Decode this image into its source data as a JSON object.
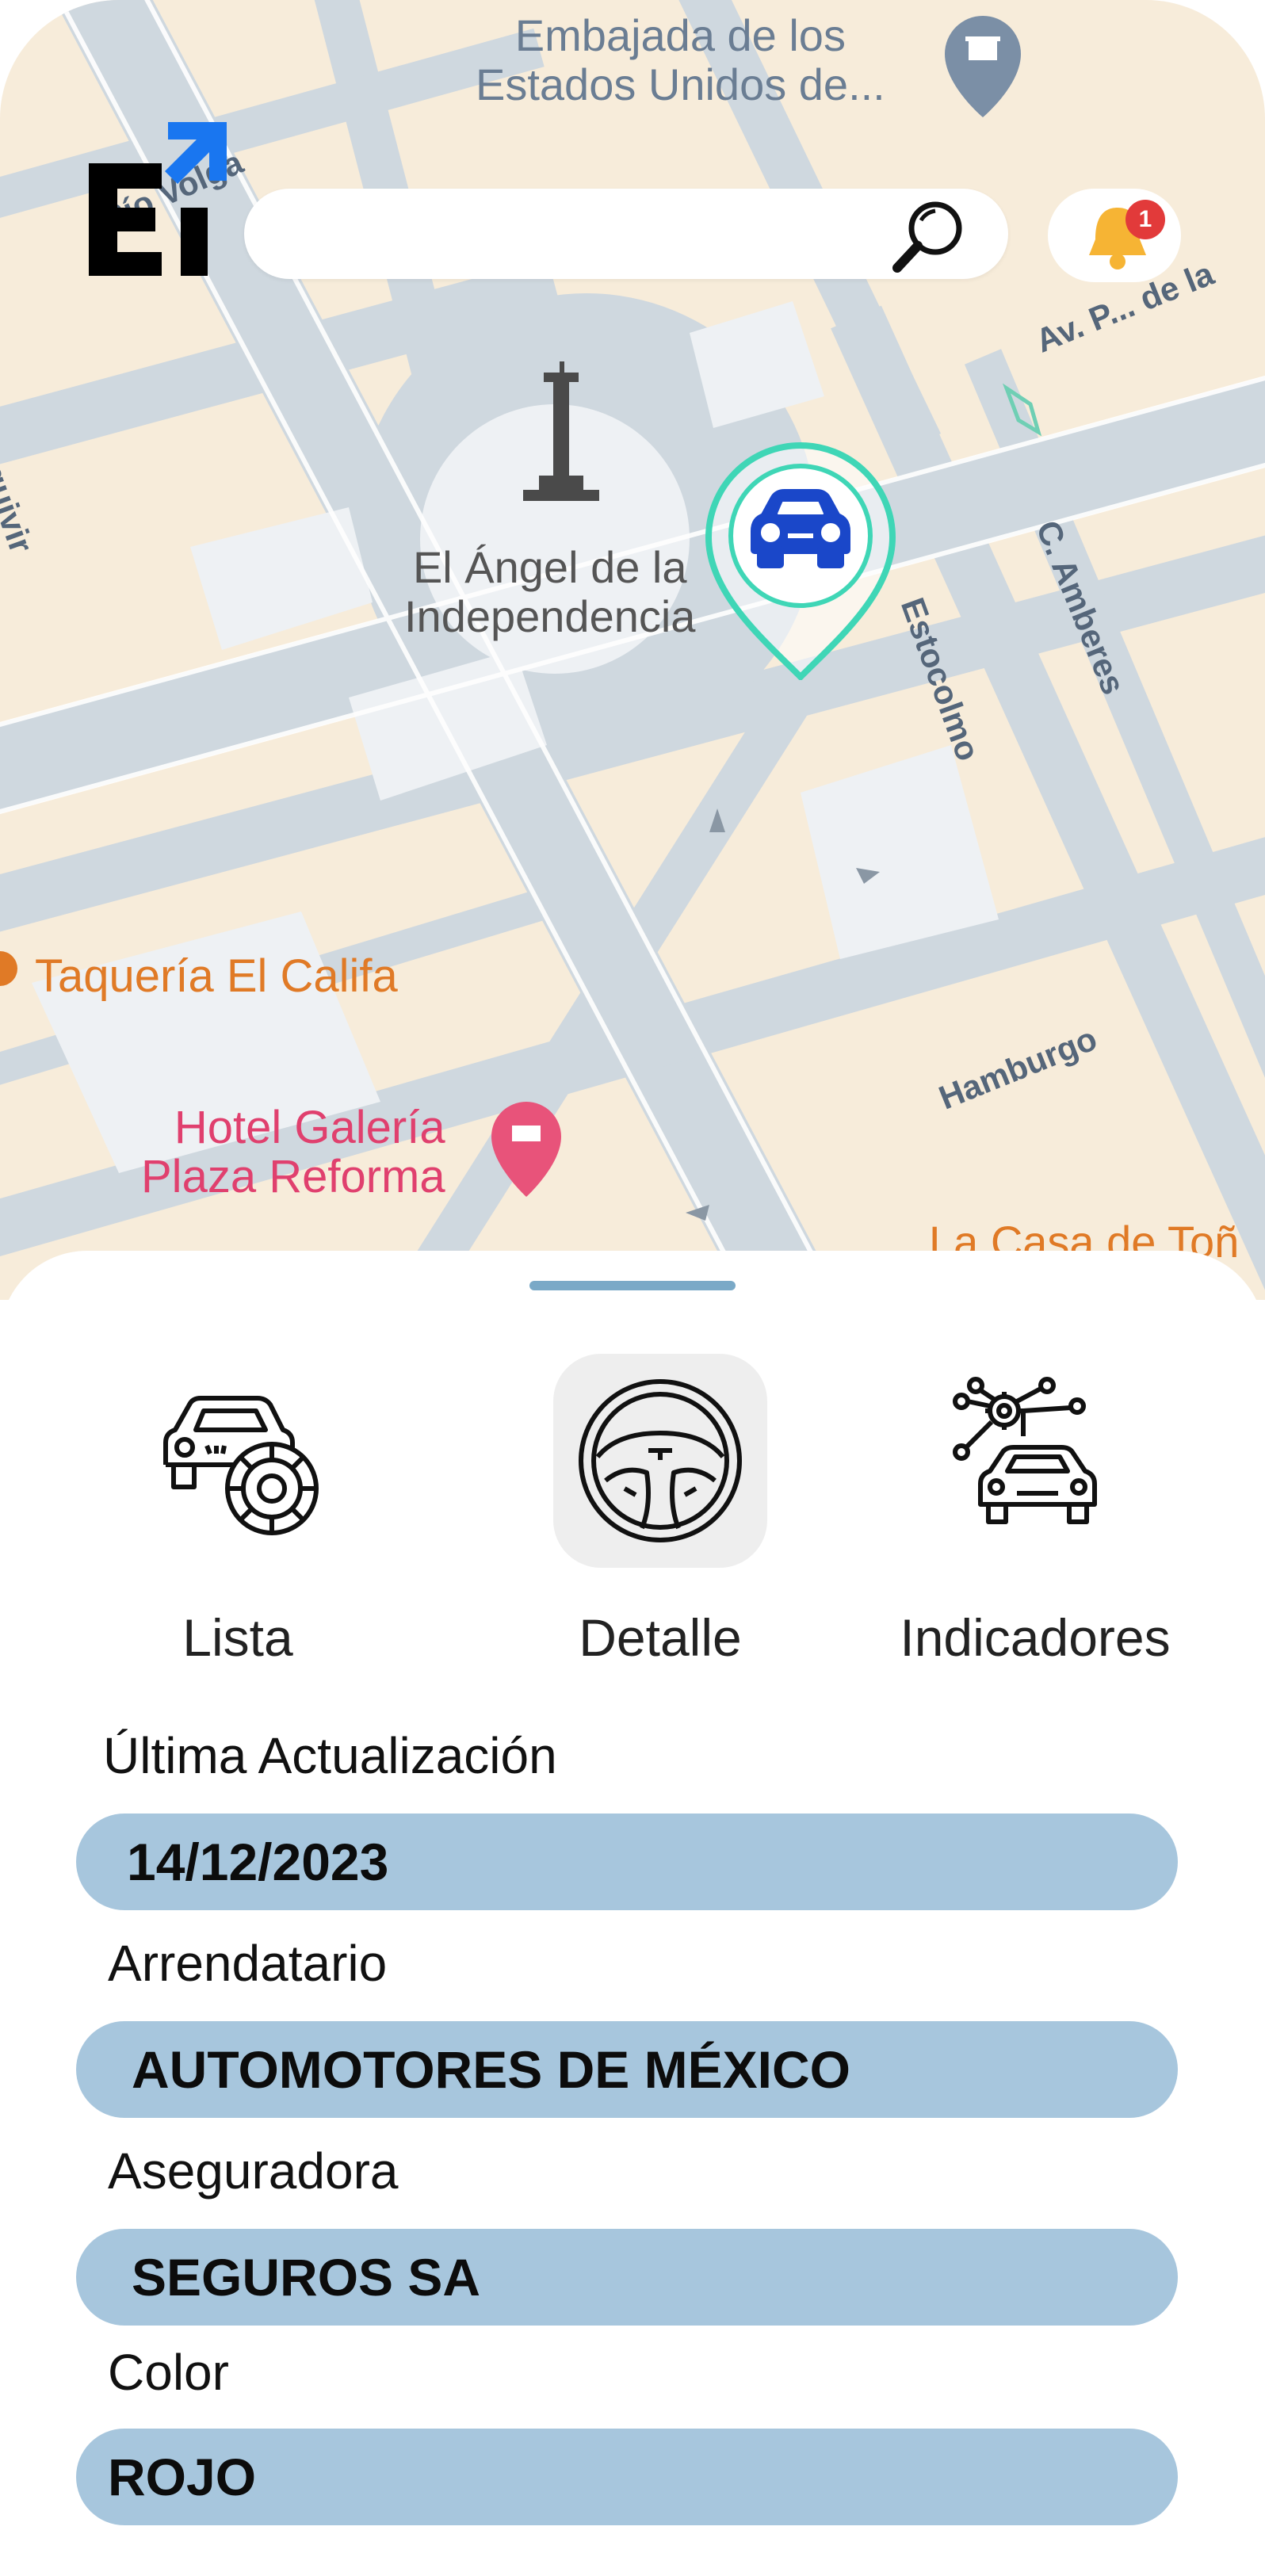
{
  "brand": {
    "logo_text": "Ei"
  },
  "search": {
    "placeholder": ""
  },
  "notifications": {
    "count": "1"
  },
  "map": {
    "labels": {
      "embassy": "Embajada de los\nEstados Unidos de...",
      "angel": "El Ángel de la\nIndependencia",
      "taqueria": "Taquería El Califa",
      "hotel": "Hotel Galería\nPlaza Reforma",
      "casa": "La Casa de Toñ",
      "rio_volga": "Río Volga",
      "av_paseo": "Av. P... de la",
      "estocolmo": "Estocolmo",
      "amberes": "C. Amberes",
      "hamburgo": "Hamburgo",
      "quivir": "quivir"
    }
  },
  "tabs": [
    {
      "id": "lista",
      "label": "Lista",
      "icon": "car-gear-icon",
      "selected": false
    },
    {
      "id": "detalle",
      "label": "Detalle",
      "icon": "steering-wheel-icon",
      "selected": true
    },
    {
      "id": "indicadores",
      "label": "Indicadores",
      "icon": "car-network-icon",
      "selected": false
    }
  ],
  "fields": [
    {
      "label": "Última Actualización",
      "value": "14/12/2023"
    },
    {
      "label": "Arrendatario",
      "value": "AUTOMOTORES DE MÉXICO"
    },
    {
      "label": "Aseguradora",
      "value": "SEGUROS SA"
    },
    {
      "label": "Color",
      "value": "ROJO"
    }
  ],
  "colors": {
    "pill": "#a7c6dd",
    "handle": "#7aa9c7",
    "pin_stroke": "#3fd6b6",
    "car_blue": "#1a47c9",
    "badge_red": "#e23a3a",
    "map_block": "#f7ecda",
    "map_road": "#cfd8df",
    "logo_blue": "#1976f0"
  }
}
